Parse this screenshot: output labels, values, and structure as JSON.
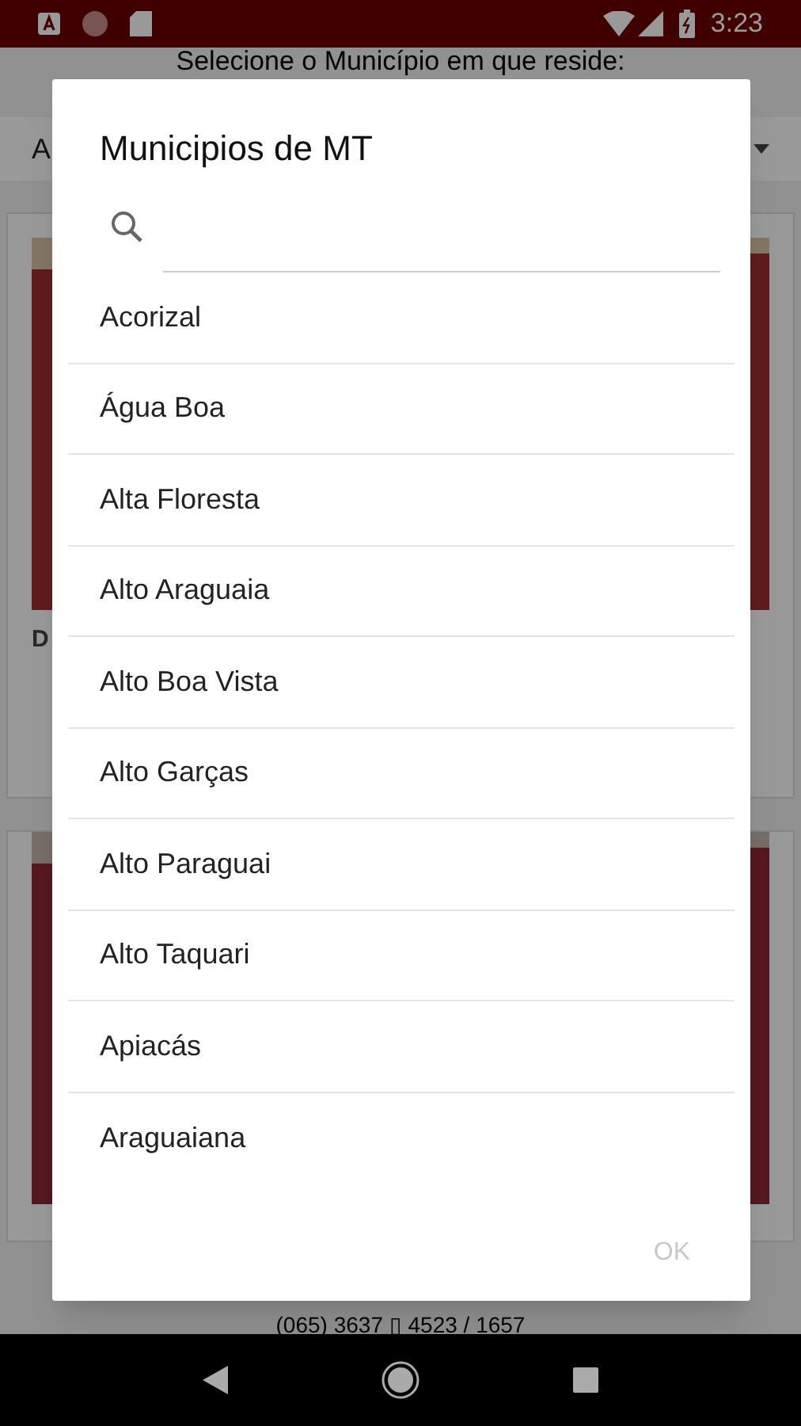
{
  "status_bar": {
    "time": "3:23"
  },
  "page": {
    "heading": "Selecione o Município em que reside:",
    "dropdown_value": "A",
    "card_label": "D",
    "phone": "(065) 3637 ▯ 4523 / 1657"
  },
  "dialog": {
    "title": "Municipios de MT",
    "items": [
      "Acorizal",
      "Água Boa",
      "Alta Floresta",
      "Alto Araguaia",
      "Alto Boa Vista",
      "Alto Garças",
      "Alto Paraguai",
      "Alto Taquari",
      "Apiacás",
      "Araguaiana"
    ],
    "ok_button": {
      "label": "OK",
      "disabled": true
    }
  }
}
